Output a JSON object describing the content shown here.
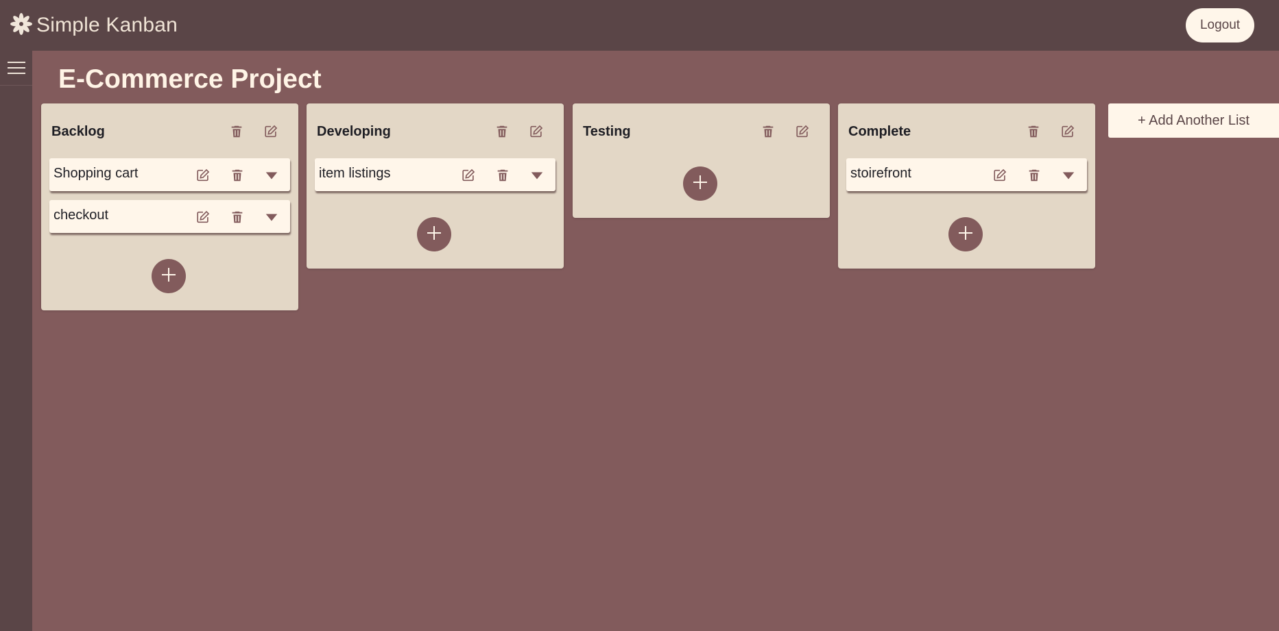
{
  "app": {
    "name": "Simple Kanban",
    "logout_label": "Logout"
  },
  "project": {
    "title": "E-Commerce Project"
  },
  "lists": [
    {
      "title": "Backlog",
      "cards": [
        {
          "title": "Shopping cart"
        },
        {
          "title": "checkout"
        }
      ]
    },
    {
      "title": "Developing",
      "cards": [
        {
          "title": "item listings"
        }
      ]
    },
    {
      "title": "Testing",
      "cards": []
    },
    {
      "title": "Complete",
      "cards": [
        {
          "title": "stoirefront"
        }
      ]
    }
  ],
  "add_list_label": "+ Add Another List",
  "colors": {
    "topbar": "#5a4547",
    "background": "#825b5c",
    "list": "#e3d7c6",
    "card": "#fff6ea",
    "icon": "#825b5c"
  },
  "icons": {
    "brand": "flower-icon",
    "menu": "hamburger-menu-icon",
    "delete": "trash-icon",
    "edit": "edit-icon",
    "expand": "caret-down-icon",
    "add": "plus-icon"
  }
}
